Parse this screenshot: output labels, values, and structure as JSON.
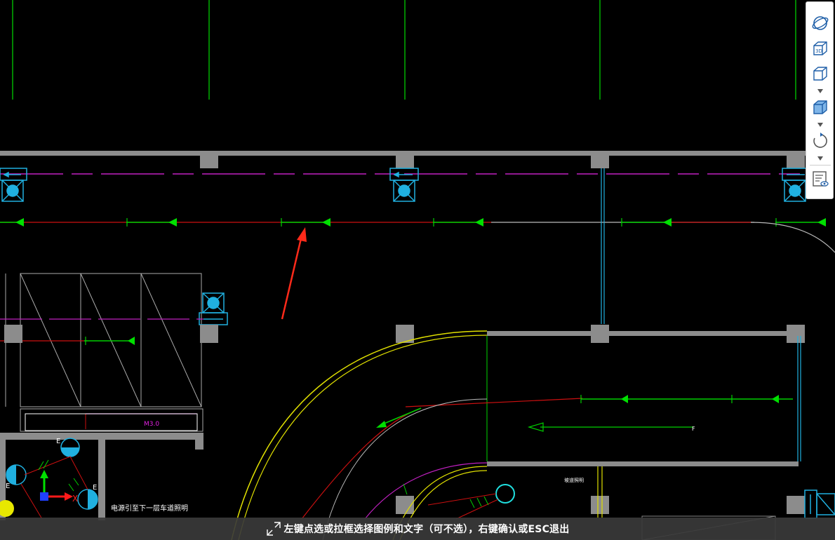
{
  "drawing": {
    "annotations": {
      "room_tag": "M3.0",
      "cable_note": "电源引至下一层车道照明",
      "ramp_tag": "坡道照明",
      "axis_x": "X",
      "axis_y": "Y",
      "fixture_mark": "E",
      "end_mark": "F"
    },
    "colors": {
      "background": "#000000",
      "cable_red": "#d01010",
      "cable_green": "#00d000",
      "dash_magenta": "#d020d0",
      "cyan_fixture": "#20b0e0",
      "wall_gray": "#8c8c8c",
      "ramp_yellow": "#e0e000",
      "arrow_annotation": "#ff2a1a"
    }
  },
  "view_toolbar": {
    "buttons": [
      {
        "name": "orbit-icon",
        "label": ""
      },
      {
        "name": "3d-view-icon",
        "label": "3D"
      },
      {
        "name": "cube-wire-icon",
        "label": ""
      },
      {
        "name": "cube-solid-icon",
        "label": ""
      },
      {
        "name": "rotate-icon",
        "label": ""
      },
      {
        "name": "display-settings-icon",
        "label": ""
      }
    ]
  },
  "hint_bar": {
    "text": "左键点选或拉框选择图例和文字（可不选），右键确认或ESC退出"
  }
}
